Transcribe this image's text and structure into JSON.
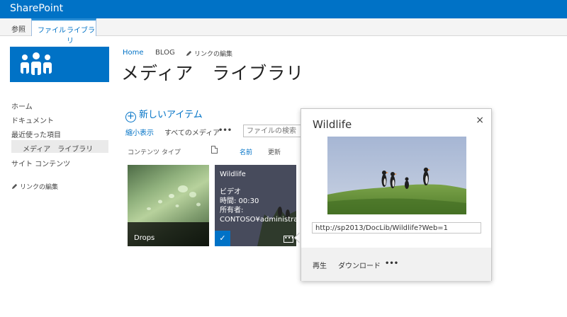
{
  "suite": {
    "brand": "SharePoint"
  },
  "ribbon": {
    "tabs": [
      "参照",
      "ファイル",
      "ライブラリ"
    ]
  },
  "breadcrumb": {
    "home": "Home",
    "blog": "BLOG",
    "edit_links": "リンクの編集"
  },
  "page": {
    "title": "メディア　ライブラリ"
  },
  "left_nav": {
    "items": [
      "ホーム",
      "ドキュメント",
      "最近使った項目",
      "メディア　ライブラリ",
      "サイト コンテンツ"
    ],
    "edit_links": "リンクの編集"
  },
  "commands": {
    "new_item": "新しいアイテム",
    "views": [
      "縮小表示",
      "すべてのメディア",
      "•••"
    ],
    "search_placeholder": "ファイルの検索"
  },
  "columns": {
    "content_type": "コンテンツ タイプ",
    "name": "名前",
    "updated": "更新"
  },
  "tiles": [
    {
      "name": "Drops"
    },
    {
      "name": "Wildlife",
      "lines": [
        "ビデオ",
        "時間: 00:30",
        "所有者:",
        "CONTOSO¥administra"
      ],
      "checked": true,
      "more": "•••"
    }
  ],
  "callout": {
    "title": "Wildlife",
    "close": "×",
    "url": "http://sp2013/DocLib/Wildlife?Web=1",
    "actions": [
      "再生",
      "ダウンロード",
      "•••"
    ]
  },
  "colors": {
    "accent": "#0072c6"
  }
}
